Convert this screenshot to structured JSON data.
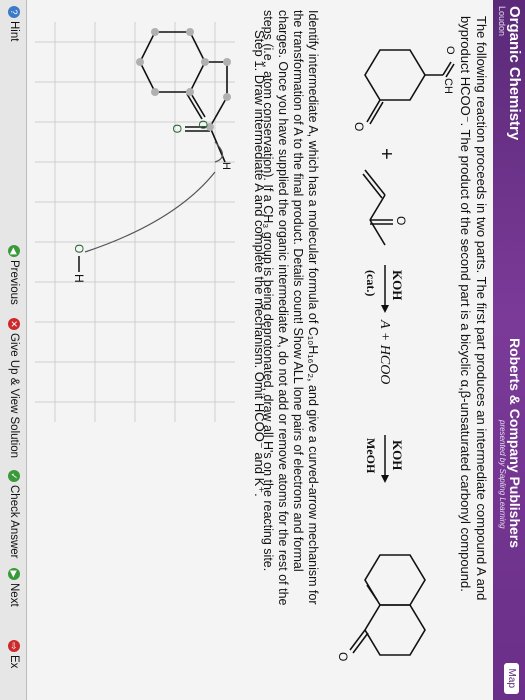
{
  "header": {
    "title": "Organic Chemistry",
    "subtitle": "Loudon",
    "publisher": "Roberts & Company Publishers",
    "presented_by": "presented by Sapling Learning",
    "map_label": "Map"
  },
  "problem": {
    "line1": "The following reaction proceeds in two parts. The first part produces an intermediate compound A and",
    "line2": "byproduct HCOO⁻. The product of the second part is a bicyclic α,β-unsaturated carbonyl compound.",
    "instr1": "Identify intermediate A, which has a molecular formula of C₁₀H₁₆O₂, and give a curved-arrow mechanism for",
    "instr2": "the transformation of A to the final product. Details count! Show ALL lone pairs of electrons and formal",
    "instr3": "charges. Once you have supplied the organic intermediate A, do not add or remove atoms for the rest of the",
    "instr4": "steps (i.e., atom conservation). If a CH₃ group is being deprotonated, draw all H's on the reacting site.",
    "step1": "Step 1. Draw intermediate A and complete the mechanism. Omit HCOO⁻ and K⁺."
  },
  "scheme": {
    "reagent1": "KOH",
    "cat": "(cat.)",
    "middle": "A + HCOO",
    "reagent2": "KOH",
    "solvent2": "MeOH",
    "plus": "+",
    "cho_label": "CH",
    "oxygen_label": "O"
  },
  "canvas": {
    "hydroxide_label": "H",
    "hydrogen_label": "H",
    "oxygen_label": "O"
  },
  "bottom": {
    "hint": "Hint",
    "previous": "Previous",
    "give_up": "Give Up & View Solution",
    "check": "Check Answer",
    "next": "Next",
    "exit": "Ex"
  },
  "colors": {
    "header": "#6a2f88",
    "check": "#3a9a3a",
    "give_up": "#cc2a2a",
    "previous": "#3a9a3a",
    "lone_pair": "#2a6a3a"
  }
}
